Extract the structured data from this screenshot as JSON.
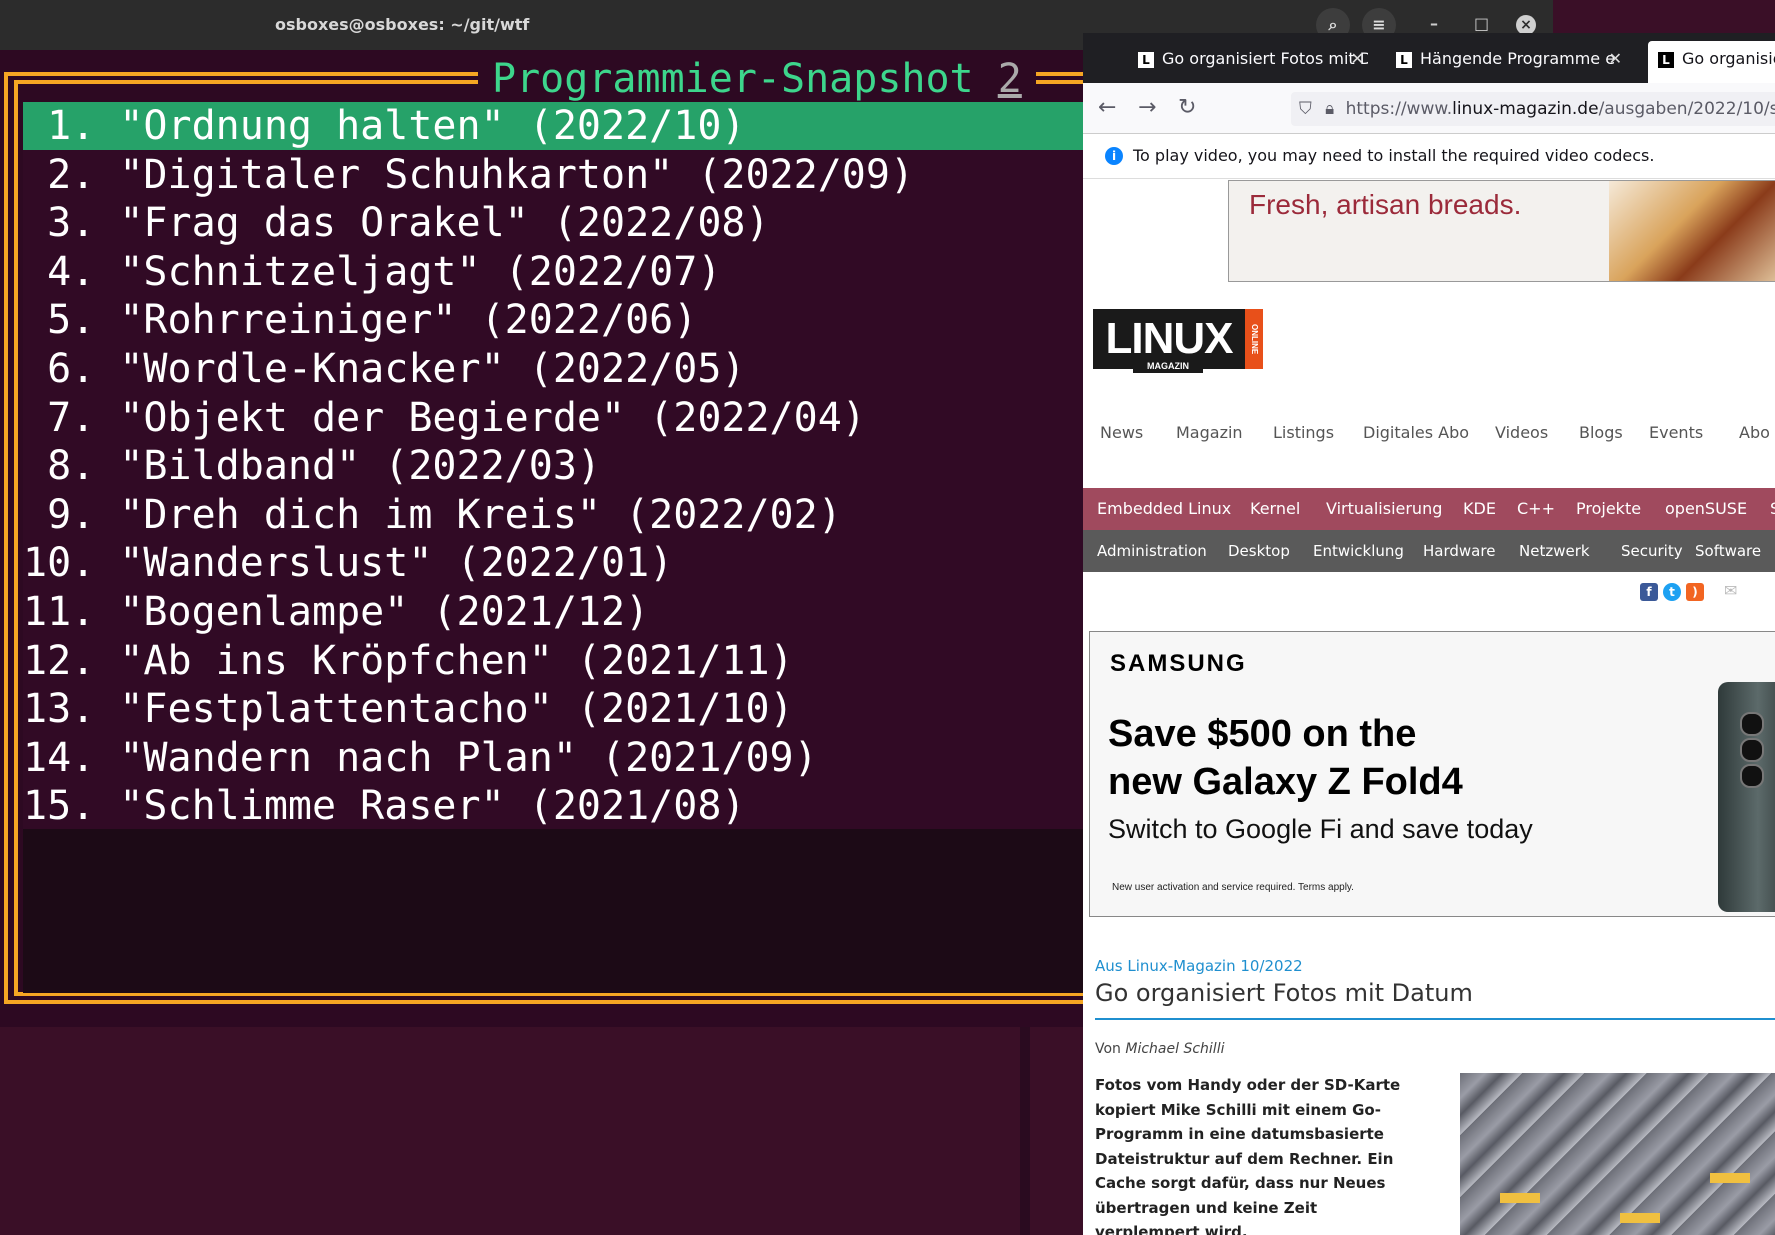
{
  "terminal": {
    "title": "osboxes@osboxes: ~/git/wtf",
    "heading": "Programmier-Snapshot",
    "heading_number": "2",
    "items": [
      {
        "num": " 1.",
        "text": "\"Ordnung halten\" (2022/10)"
      },
      {
        "num": " 2.",
        "text": "\"Digitaler Schuhkarton\" (2022/09)"
      },
      {
        "num": " 3.",
        "text": "\"Frag das Orakel\" (2022/08)"
      },
      {
        "num": " 4.",
        "text": "\"Schnitzeljagt\" (2022/07)"
      },
      {
        "num": " 5.",
        "text": "\"Rohrreiniger\" (2022/06)"
      },
      {
        "num": " 6.",
        "text": "\"Wordle-Knacker\" (2022/05)"
      },
      {
        "num": " 7.",
        "text": "\"Objekt der Begierde\" (2022/04)"
      },
      {
        "num": " 8.",
        "text": "\"Bildband\" (2022/03)"
      },
      {
        "num": " 9.",
        "text": "\"Dreh dich im Kreis\" (2022/02)"
      },
      {
        "num": "10.",
        "text": "\"Wanderslust\" (2022/01)"
      },
      {
        "num": "11.",
        "text": "\"Bogenlampe\" (2021/12)"
      },
      {
        "num": "12.",
        "text": "\"Ab ins Kröpfchen\" (2021/11)"
      },
      {
        "num": "13.",
        "text": "\"Festplattentacho\" (2021/10)"
      },
      {
        "num": "14.",
        "text": "\"Wandern nach Plan\" (2021/09)"
      },
      {
        "num": "15.",
        "text": "\"Schlimme Raser\" (2021/08)"
      }
    ],
    "selected_index": 0,
    "colors": {
      "frame": "#f5a623",
      "selected": "#26a269",
      "heading": "#3dd68c"
    }
  },
  "browser": {
    "tabs": [
      {
        "label": "Go organisiert Fotos mit D",
        "favicon": "L"
      },
      {
        "label": "Hängende Programme e",
        "favicon": "L"
      },
      {
        "label": "Go organisie",
        "favicon": "L"
      }
    ],
    "url_prefix": "https://www.",
    "url_host": "linux-magazin.de",
    "url_path": "/ausgaben/2022/10/s",
    "infobar": "To play video, you may need to install the required video codecs.",
    "ad_top": "Fresh, artisan breads.",
    "logo": {
      "main": "LINUX",
      "sub": "MAGAZIN",
      "online": "ONLINE"
    },
    "main_nav": [
      "News",
      "Magazin",
      "Listings",
      "Digitales Abo",
      "Videos",
      "Blogs",
      "Events",
      "Abo"
    ],
    "categories_1": [
      "Embedded Linux",
      "Kernel",
      "Virtualisierung",
      "KDE",
      "C++",
      "Projekte",
      "openSUSE",
      "S"
    ],
    "categories_2": [
      "Administration",
      "Desktop",
      "Entwicklung",
      "Hardware",
      "Netzwerk",
      "Security",
      "Software"
    ],
    "ad_samsung": {
      "brand": "SAMSUNG",
      "headline_1": "Save $500 on the",
      "headline_2": "new Galaxy Z Fold4",
      "sub": "Switch to Google Fi and save today",
      "fine": "New user activation and service required. Terms apply."
    },
    "article": {
      "kicker": "Aus Linux-Magazin 10/2022",
      "title": "Go organisiert Fotos mit Datum",
      "byline_prefix": "Von ",
      "author": "Michael Schilli",
      "teaser": "Fotos vom Handy oder der SD-Karte kopiert Mike Schilli mit einem Go-Programm in eine datumsbasierte Dateistruktur auf dem Rechner. Ein Cache sorgt dafür, dass nur Neues übertragen und keine Zeit verplempert wird."
    }
  }
}
